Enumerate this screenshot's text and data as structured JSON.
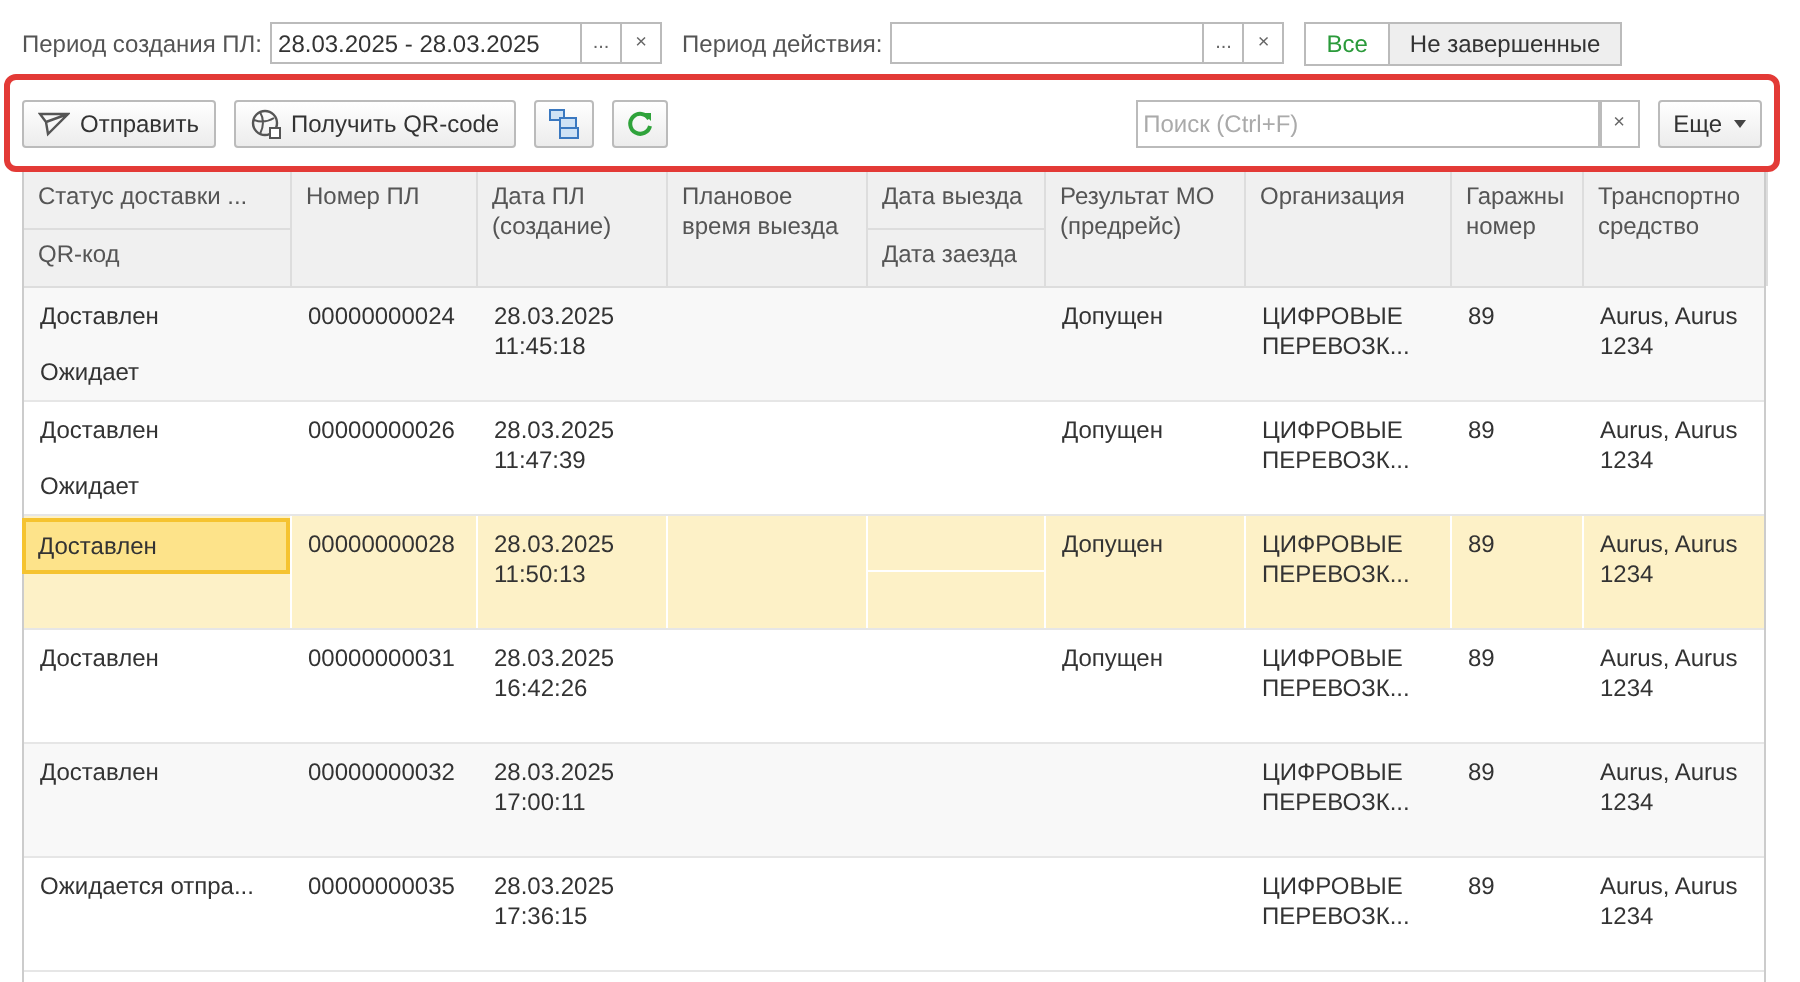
{
  "filters": {
    "created_label": "Период создания ПЛ:",
    "created_value": "28.03.2025 - 28.03.2025",
    "choose_button": "...",
    "clear_button": "×",
    "action_label": "Период действия:",
    "action_choose_button": "...",
    "action_clear_button": "×",
    "tabs": [
      {
        "label": "Все",
        "selected": true
      },
      {
        "label": "Не завершенные",
        "selected": false
      }
    ]
  },
  "toolbar": {
    "send_button": "Отправить",
    "qr_button": "Получить QR-code",
    "search_placeholder": "Поиск (Ctrl+F)",
    "search_clear": "×",
    "more_button": "Еще"
  },
  "table": {
    "columns": [
      {
        "label": "Статус доставки ...",
        "sub_label": "QR-код"
      },
      {
        "label": "Номер ПЛ"
      },
      {
        "label": "Дата ПЛ (создание)"
      },
      {
        "label": "Плановое время выезда"
      },
      {
        "label": "Дата выезда",
        "sub_label": "Дата заезда"
      },
      {
        "label": "Результат МО (предрейс)"
      },
      {
        "label": "Организация"
      },
      {
        "label": "Гаражны номер"
      },
      {
        "label": "Транспортно средство"
      }
    ],
    "rows": [
      {
        "status": "Доставлен",
        "qr": "Ожидает",
        "number": "00000000024",
        "date": "28.03.2025",
        "time": "11:45:18",
        "result": "Допущен",
        "org": "ЦИФРОВЫЕ ПЕРЕВОЗК...",
        "garage": "89",
        "vehicle": "Aurus, Aurus 1234",
        "selected": false
      },
      {
        "status": "Доставлен",
        "qr": "Ожидает",
        "number": "00000000026",
        "date": "28.03.2025",
        "time": "11:47:39",
        "result": "Допущен",
        "org": "ЦИФРОВЫЕ ПЕРЕВОЗК...",
        "garage": "89",
        "vehicle": "Aurus, Aurus 1234",
        "selected": false
      },
      {
        "status": "Доставлен",
        "number": "00000000028",
        "date": "28.03.2025",
        "time": "11:50:13",
        "result": "Допущен",
        "org": "ЦИФРОВЫЕ ПЕРЕВОЗК...",
        "garage": "89",
        "vehicle": "Aurus, Aurus 1234",
        "selected": true
      },
      {
        "status": "Доставлен",
        "number": "00000000031",
        "date": "28.03.2025",
        "time": "16:42:26",
        "result": "Допущен",
        "org": "ЦИФРОВЫЕ ПЕРЕВОЗК...",
        "garage": "89",
        "vehicle": "Aurus, Aurus 1234",
        "selected": false
      },
      {
        "status": "Доставлен",
        "number": "00000000032",
        "date": "28.03.2025",
        "time": "17:00:11",
        "org": "ЦИФРОВЫЕ ПЕРЕВОЗК...",
        "garage": "89",
        "vehicle": "Aurus, Aurus 1234",
        "selected": false
      },
      {
        "status": "Ожидается отпра...",
        "number": "00000000035",
        "date": "28.03.2025",
        "time": "17:36:15",
        "org": "ЦИФРОВЫЕ ПЕРЕВОЗК...",
        "garage": "89",
        "vehicle": "Aurus, Aurus 1234",
        "selected": false
      }
    ]
  }
}
